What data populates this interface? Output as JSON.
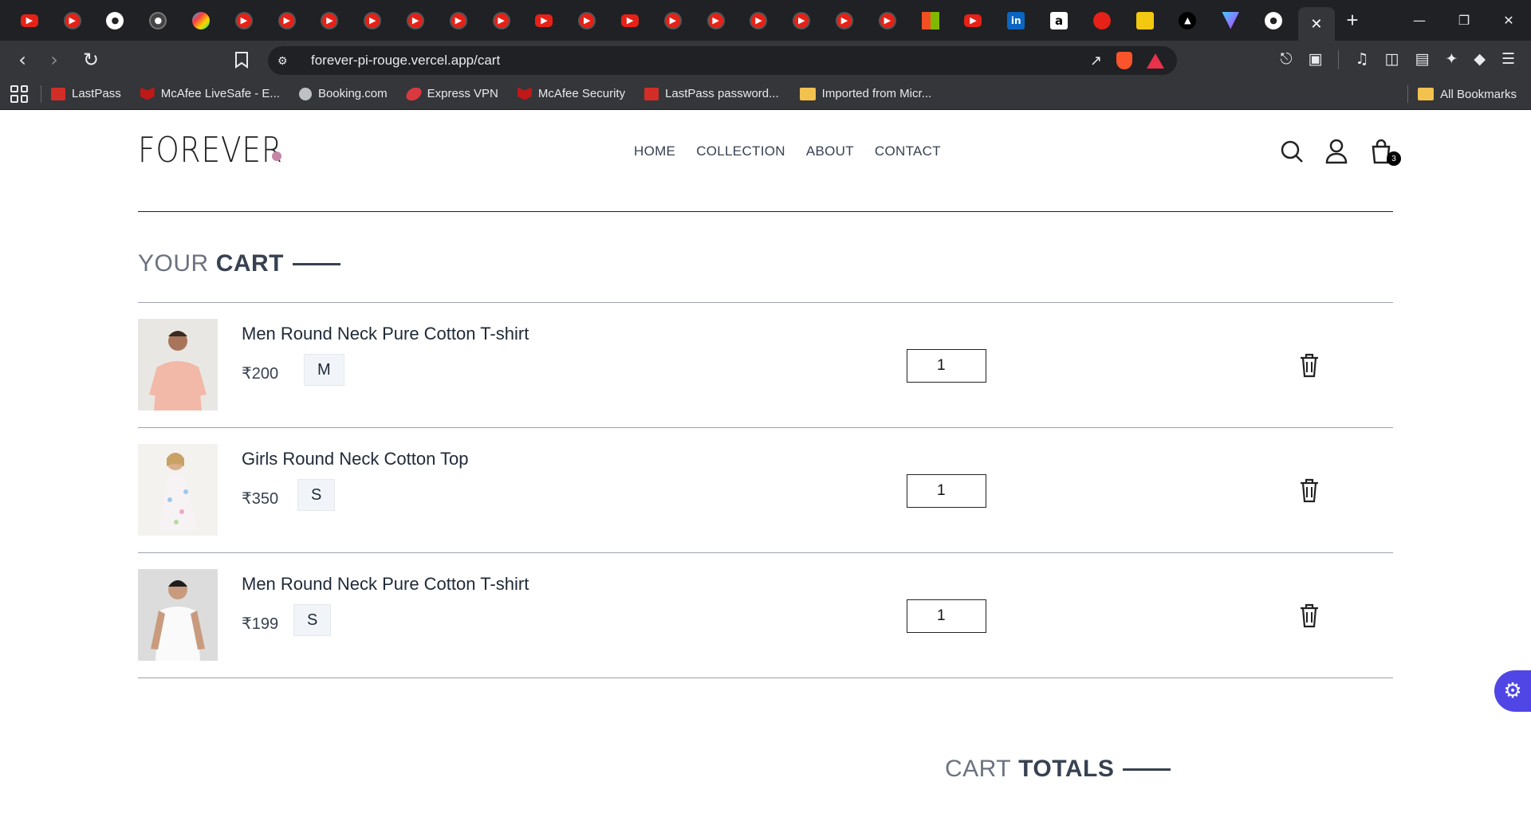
{
  "browser": {
    "tabs": [
      "youtube",
      "youtube-circle",
      "github",
      "github-circle",
      "google-play",
      "youtube-circle",
      "youtube-circle",
      "youtube-circle",
      "youtube-circle",
      "youtube-circle",
      "youtube-circle",
      "youtube-circle",
      "youtube",
      "youtube-circle",
      "youtube",
      "youtube-circle",
      "youtube-circle",
      "youtube-circle",
      "youtube-circle",
      "youtube-circle",
      "youtube-circle",
      "microsoft",
      "youtube",
      "linkedin",
      "amazon",
      "red-swirl",
      "power-bi",
      "vercel",
      "vite",
      "github"
    ],
    "active_tab_icon": "close-icon",
    "url": "forever-pi-rouge.vercel.app/cart",
    "bookmarks": [
      {
        "label": "LastPass",
        "icon": "lastpass"
      },
      {
        "label": "McAfee LiveSafe - E...",
        "icon": "mcafee"
      },
      {
        "label": "Booking.com",
        "icon": "globe"
      },
      {
        "label": "Express VPN",
        "icon": "expressvpn"
      },
      {
        "label": "McAfee Security",
        "icon": "mcafee"
      },
      {
        "label": "LastPass password...",
        "icon": "lastpass"
      },
      {
        "label": "Imported from Micr...",
        "icon": "folder"
      }
    ],
    "all_bookmarks": "All Bookmarks"
  },
  "site": {
    "logo": "FOREVER",
    "nav": [
      "HOME",
      "COLLECTION",
      "ABOUT",
      "CONTACT"
    ],
    "cart_count": "3"
  },
  "cart": {
    "title_light": "YOUR",
    "title_bold": "CART",
    "items": [
      {
        "name": "Men Round Neck Pure Cotton T-shirt",
        "price": "₹200",
        "size": "M",
        "qty": "1"
      },
      {
        "name": "Girls Round Neck Cotton Top",
        "price": "₹350",
        "size": "S",
        "qty": "1"
      },
      {
        "name": "Men Round Neck Pure Cotton T-shirt",
        "price": "₹199",
        "size": "S",
        "qty": "1"
      }
    ]
  },
  "totals": {
    "title_light": "CART",
    "title_bold": "TOTALS"
  },
  "colors": {
    "accent_dot": "#c586a5",
    "floater": "#4f46e5"
  }
}
